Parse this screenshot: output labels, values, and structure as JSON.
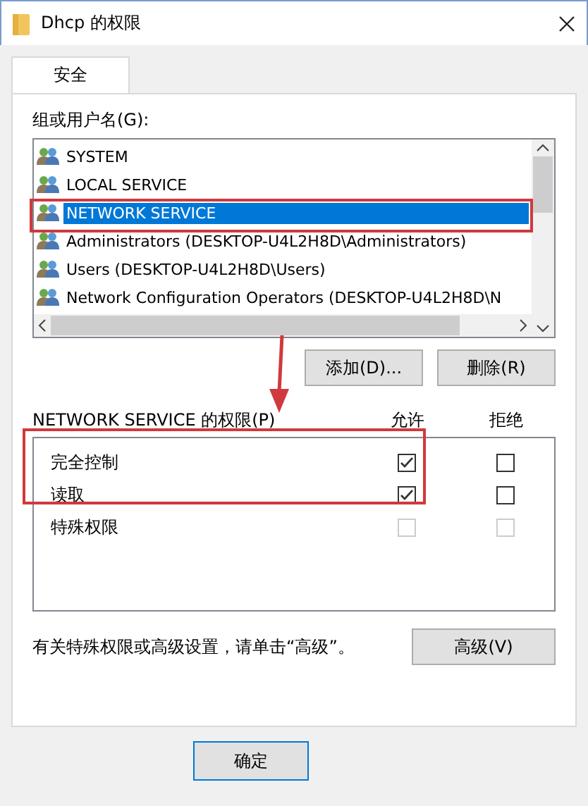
{
  "window": {
    "title": "Dhcp 的权限"
  },
  "tabs": [
    {
      "label": "安全",
      "selected": true
    }
  ],
  "group_label": "组或用户名(G):",
  "users": [
    {
      "name": "SYSTEM",
      "selected": false
    },
    {
      "name": "LOCAL SERVICE",
      "selected": false
    },
    {
      "name": "NETWORK SERVICE",
      "selected": true
    },
    {
      "name": "Administrators (DESKTOP-U4L2H8D\\Administrators)",
      "selected": false
    },
    {
      "name": "Users (DESKTOP-U4L2H8D\\Users)",
      "selected": false
    },
    {
      "name": "Network Configuration Operators (DESKTOP-U4L2H8D\\N",
      "selected": false
    }
  ],
  "user_buttons": [
    "添加(D)...",
    "删除(R)"
  ],
  "permissions": {
    "title": "NETWORK SERVICE 的权限(P)",
    "columns": [
      "允许",
      "拒绝"
    ],
    "rows": [
      {
        "name": "完全控制",
        "allow_checked": true,
        "deny_checked": false,
        "disabled": false
      },
      {
        "name": "读取",
        "allow_checked": true,
        "deny_checked": false,
        "disabled": false
      },
      {
        "name": "特殊权限",
        "allow_checked": false,
        "deny_checked": false,
        "disabled": true
      }
    ]
  },
  "advanced_hint": "有关特殊权限或高级设置，请单击“高级”。",
  "advanced_button": "高级(V)",
  "dialog_buttons": [
    {
      "label": "确定",
      "default": true
    }
  ]
}
